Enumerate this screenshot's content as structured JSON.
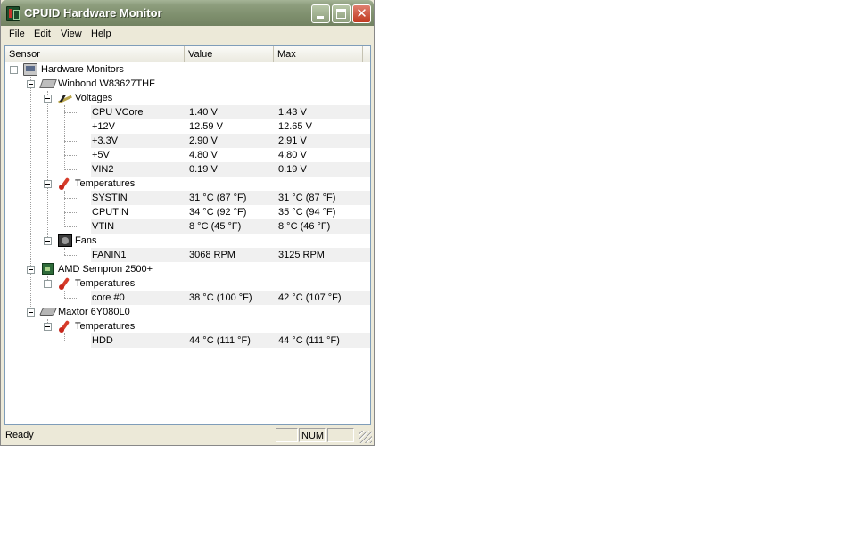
{
  "window": {
    "title": "CPUID Hardware Monitor"
  },
  "menu": [
    {
      "label": "File"
    },
    {
      "label": "Edit"
    },
    {
      "label": "View"
    },
    {
      "label": "Help"
    }
  ],
  "columns": {
    "sensor": "Sensor",
    "value": "Value",
    "max": "Max"
  },
  "tree": {
    "root": "Hardware Monitors",
    "devices": [
      {
        "name": "Winbond W83627THF",
        "icon": "chip-icon"
      },
      {
        "name": "AMD Sempron 2500+",
        "icon": "cpu-icon"
      },
      {
        "name": "Maxtor 6Y080L0",
        "icon": "hdd-icon"
      }
    ],
    "groups": {
      "voltages": "Voltages",
      "temperatures": "Temperatures",
      "fans": "Fans"
    },
    "sensors": [
      {
        "name": "CPU VCore",
        "value": "1.40 V",
        "max": "1.43 V"
      },
      {
        "name": "+12V",
        "value": "12.59 V",
        "max": "12.65 V"
      },
      {
        "name": "+3.3V",
        "value": "2.90 V",
        "max": "2.91 V"
      },
      {
        "name": "+5V",
        "value": "4.80 V",
        "max": "4.80 V"
      },
      {
        "name": "VIN2",
        "value": "0.19 V",
        "max": "0.19 V"
      },
      {
        "name": "SYSTIN",
        "value": "31 °C  (87 °F)",
        "max": "31 °C  (87 °F)"
      },
      {
        "name": "CPUTIN",
        "value": "34 °C  (92 °F)",
        "max": "35 °C  (94 °F)"
      },
      {
        "name": "VTIN",
        "value": "8 °C  (45 °F)",
        "max": "8 °C  (46 °F)"
      },
      {
        "name": "FANIN1",
        "value": "3068 RPM",
        "max": "3125 RPM"
      },
      {
        "name": "core #0",
        "value": "38 °C  (100 °F)",
        "max": "42 °C  (107 °F)"
      },
      {
        "name": "HDD",
        "value": "44 °C  (111 °F)",
        "max": "44 °C  (111 °F)"
      }
    ]
  },
  "status": {
    "text": "Ready",
    "num": "NUM"
  }
}
